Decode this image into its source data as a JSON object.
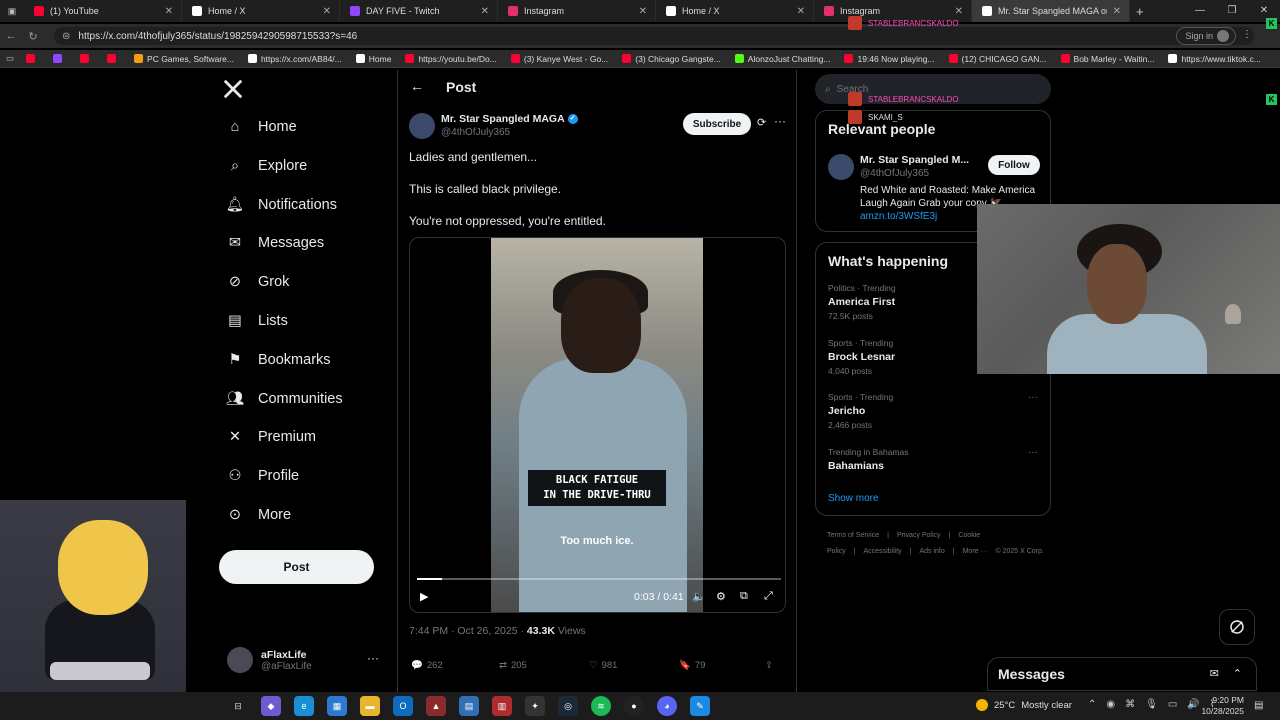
{
  "browser": {
    "tabs": [
      {
        "label": "(1) YouTube",
        "icon": "youtube-icon",
        "color": "#ff0033"
      },
      {
        "label": "Home / X",
        "icon": "x-logo-icon",
        "color": "#ffffff"
      },
      {
        "label": "DAY FIVE - Twitch",
        "icon": "twitch-icon",
        "color": "#9146ff"
      },
      {
        "label": "Instagram",
        "icon": "instagram-icon",
        "color": "#e1306c"
      },
      {
        "label": "Home / X",
        "icon": "x-logo-icon",
        "color": "#ffffff"
      },
      {
        "label": "Instagram",
        "icon": "instagram-icon",
        "color": "#e1306c"
      },
      {
        "label": "Mr. Star Spangled MAGA on X: \"",
        "icon": "x-logo-icon",
        "color": "#ffffff"
      }
    ],
    "new_tab": "+",
    "url": "https://x.com/4thofjuly365/status/1982594290598715533?s=46",
    "sign_in": "Sign in",
    "bookmarks": [
      {
        "label": "",
        "color": "#ff0033"
      },
      {
        "label": "",
        "color": "#9146ff"
      },
      {
        "label": "",
        "color": "#ff0033"
      },
      {
        "label": "",
        "color": "#ff0033"
      },
      {
        "label": "PC Games, Software...",
        "color": "#f59e0b"
      },
      {
        "label": "https://x.com/AB84/...",
        "color": "#ffffff"
      },
      {
        "label": "Home",
        "color": "#ffffff"
      },
      {
        "label": "https://youtu.be/Do...",
        "color": "#ff0033"
      },
      {
        "label": "(3) Kanye West - Go...",
        "color": "#ff0033"
      },
      {
        "label": "(3) Chicago Gangste...",
        "color": "#ff0033"
      },
      {
        "label": "AlonzoJust Chatting...",
        "color": "#53fc18"
      },
      {
        "label": "19:46 Now playing...",
        "color": "#ff0033"
      },
      {
        "label": "(12) CHICAGO GAN...",
        "color": "#ff0033"
      },
      {
        "label": "Bob Marley - Waitin...",
        "color": "#ff0033"
      },
      {
        "label": "https://www.tiktok.c...",
        "color": "#ffffff"
      }
    ]
  },
  "nav": {
    "items": [
      {
        "label": "Home",
        "icon": "home-icon"
      },
      {
        "label": "Explore",
        "icon": "search-icon"
      },
      {
        "label": "Notifications",
        "icon": "bell-icon"
      },
      {
        "label": "Messages",
        "icon": "envelope-icon"
      },
      {
        "label": "Grok",
        "icon": "grok-icon"
      },
      {
        "label": "Lists",
        "icon": "list-icon"
      },
      {
        "label": "Bookmarks",
        "icon": "bookmark-icon"
      },
      {
        "label": "Communities",
        "icon": "people-icon"
      },
      {
        "label": "Premium",
        "icon": "x-logo-icon"
      },
      {
        "label": "Profile",
        "icon": "person-icon"
      },
      {
        "label": "More",
        "icon": "more-circle-icon"
      }
    ],
    "post_button": "Post",
    "account": {
      "name": "aFlaxLife",
      "handle": "@aFlaxLife",
      "more": "···"
    }
  },
  "post": {
    "header_title": "Post",
    "author_name": "Mr. Star Spangled MAGA",
    "author_handle": "@4thOfJuly365",
    "subscribe": "Subscribe",
    "more": "···",
    "lines": [
      "Ladies and gentlemen...",
      "This is called black privilege.",
      "You're not oppressed, you're entitled."
    ],
    "video": {
      "caption_line1": "BLACK FATIGUE",
      "caption_line2": "IN THE DRIVE-THRU",
      "subtitle": "Too much ice.",
      "time": "0:03 / 0:41",
      "progress": 0.07
    },
    "timestamp": "7:44 PM · Oct 26, 2025 · ",
    "views_count": "43.3K",
    "views_label": " Views",
    "stats": {
      "replies": "262",
      "reposts": "205",
      "likes": "981",
      "bookmarks": "79"
    }
  },
  "sidebar": {
    "search_placeholder": "Search",
    "relevant_title": "Relevant people",
    "relevant": {
      "name": "Mr. Star Spangled M...",
      "handle": "@4thOfJuly365",
      "follow": "Follow",
      "bio": "Red White and Roasted: Make America Laugh Again Grab your copy 🦅",
      "link": "amzn.to/3WSfE3j"
    },
    "happening_title": "What's happening",
    "trends": [
      {
        "category": "Politics · Trending",
        "name": "America First",
        "count": "72.5K posts"
      },
      {
        "category": "Sports · Trending",
        "name": "Brock Lesnar",
        "count": "4,040 posts"
      },
      {
        "category": "Sports · Trending",
        "name": "Jericho",
        "count": "2,466 posts"
      },
      {
        "category": "Trending in Bahamas",
        "name": "Bahamians",
        "count": ""
      }
    ],
    "show_more": "Show more",
    "footer": [
      "Terms of Service",
      "|",
      "Privacy Policy",
      "|",
      "Cookie Policy",
      "|",
      "Accessibility",
      "|",
      "Ads info",
      "|",
      "More ···",
      "© 2025 X Corp."
    ]
  },
  "messages_drawer": {
    "title": "Messages"
  },
  "overlay_chat": {
    "lines": [
      "STABLEBRANCSKALDO",
      "STABLEBRANCSKALDO",
      "SKAMI_S"
    ]
  },
  "taskbar": {
    "weather_temp": "25°C",
    "weather_text": "Mostly clear",
    "time": "9:20 PM",
    "date": "10/28/2025"
  }
}
